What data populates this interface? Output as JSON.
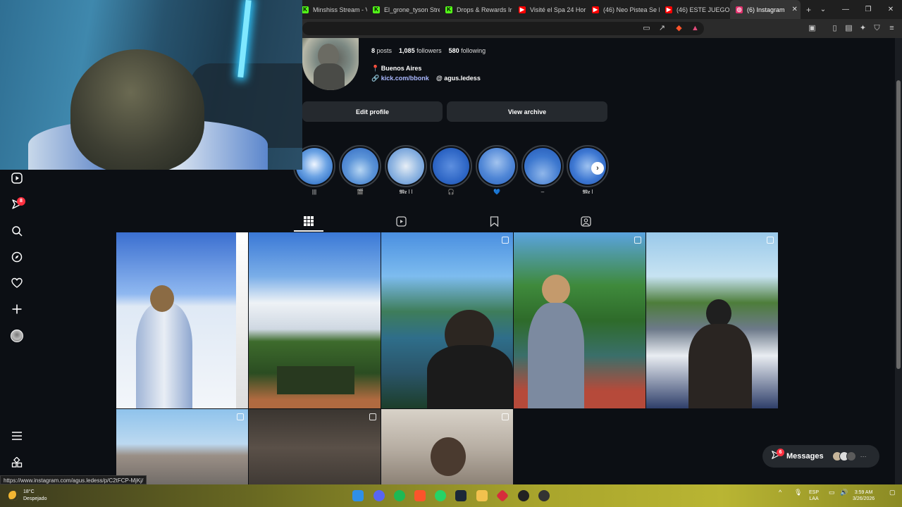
{
  "browser": {
    "tabs": [
      {
        "label": "Minshiss Stream - V",
        "color": "#53fc18",
        "glyph": "K"
      },
      {
        "label": "El_grone_tyson Stre",
        "color": "#53fc18",
        "glyph": "K"
      },
      {
        "label": "Drops & Rewards Ir",
        "color": "#53fc18",
        "glyph": "K"
      },
      {
        "label": "Visité el Spa 24 Hor",
        "color": "#ff0000",
        "glyph": "▶"
      },
      {
        "label": "(46) Neo Pistea Se I",
        "color": "#ff0000",
        "glyph": "▶"
      },
      {
        "label": "(46) ESTE JUEGO DI",
        "color": "#ff0000",
        "glyph": "▶"
      },
      {
        "label": "(6) Instagram",
        "color": "#e1306c",
        "glyph": "◎",
        "active": true
      }
    ],
    "new_tab": "+",
    "window_controls": [
      "⌄",
      "—",
      "❐",
      "✕"
    ],
    "status_url": "https://www.instagram.com/agus.ledess/p/C2tFCP-MjKj/"
  },
  "profile": {
    "stats": {
      "posts": "8",
      "posts_label": "posts",
      "followers": "1,085",
      "followers_label": "followers",
      "following": "580",
      "following_label": "following"
    },
    "location": "Buenos Aires",
    "link": "kick.com/bbonk",
    "threads_handle": "agus.ledess",
    "edit_profile": "Edit profile",
    "view_archive": "View archive"
  },
  "stories": [
    {
      "label": "|||"
    },
    {
      "label": "🎬"
    },
    {
      "label": "𝕸𝖊 l l"
    },
    {
      "label": "🎧"
    },
    {
      "label": "💙"
    },
    {
      "label": "–"
    },
    {
      "label": "𝕸𝖊 l"
    }
  ],
  "nav": {
    "notifications_badge": "8"
  },
  "messages": {
    "label": "Messages",
    "badge": "6"
  },
  "taskbar": {
    "temperature": "18°C",
    "weather": "Despejado",
    "lang": "ESP",
    "lang2": "LAA",
    "time": "3:59 AM",
    "date": "3/26/2026"
  },
  "colors": {
    "accent_link": "#aab8ff",
    "badge": "#ff3040",
    "button_bg": "#25292e"
  }
}
